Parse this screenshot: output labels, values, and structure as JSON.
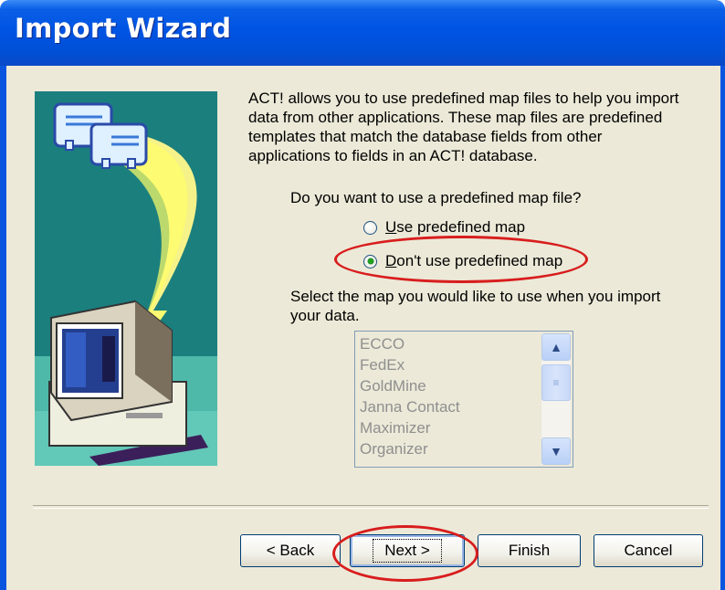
{
  "window": {
    "title": "Import Wizard"
  },
  "intro": "ACT! allows you to use predefined map files to help you import\ndata from other applications.  These map files are predefined\ntemplates that match the database fields from other\napplications to fields in an ACT! database.",
  "question": "Do you want to use a predefined map file?",
  "options": [
    {
      "label": "Use predefined map",
      "selected": false
    },
    {
      "label": "Don't use predefined map",
      "selected": true
    }
  ],
  "select_text": "Select the map you would like to use when you import\nyour data.",
  "map_list": [
    "ECCO",
    "FedEx",
    "GoldMine",
    "Janna Contact",
    "Maximizer",
    "Organizer"
  ],
  "buttons": {
    "back": "< Back",
    "next": "Next >",
    "finish": "Finish",
    "cancel": "Cancel"
  },
  "colors": {
    "title_bar": "#0054e3",
    "dialog_bg": "#ece9d8",
    "highlight": "#d81d1d"
  }
}
